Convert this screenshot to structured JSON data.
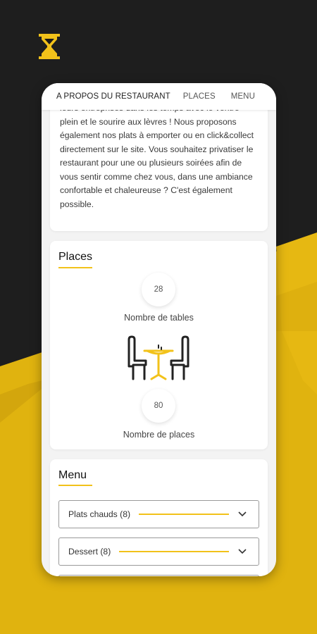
{
  "tabs": [
    "A PROPOS DU RESTAURANT",
    "PLACES",
    "MENU"
  ],
  "about": {
    "text": "leurs entreprises dans les temps avec le ventre plein et le sourire aux lèvres ! Nous proposons également nos plats à emporter ou en click&collect directement sur le site. Vous souhaitez privatiser le restaurant pour une ou plusieurs soirées afin de vous sentir comme chez vous, dans une ambiance confortable et chaleureuse ? C'est également possible."
  },
  "places": {
    "title": "Places",
    "tables_count": "28",
    "tables_label": "Nombre de tables",
    "places_count": "80",
    "places_label": "Nombre de places"
  },
  "menu": {
    "title": "Menu",
    "categories": [
      {
        "label": "Plats chauds (8)"
      },
      {
        "label": "Dessert (8)"
      }
    ]
  },
  "colors": {
    "accent": "#f2c21a",
    "background_dark": "#1a1a1a",
    "card": "#ffffff"
  },
  "icons": [
    "hourglass-logo-icon",
    "chevron-down-icon",
    "table-chairs-icon"
  ]
}
